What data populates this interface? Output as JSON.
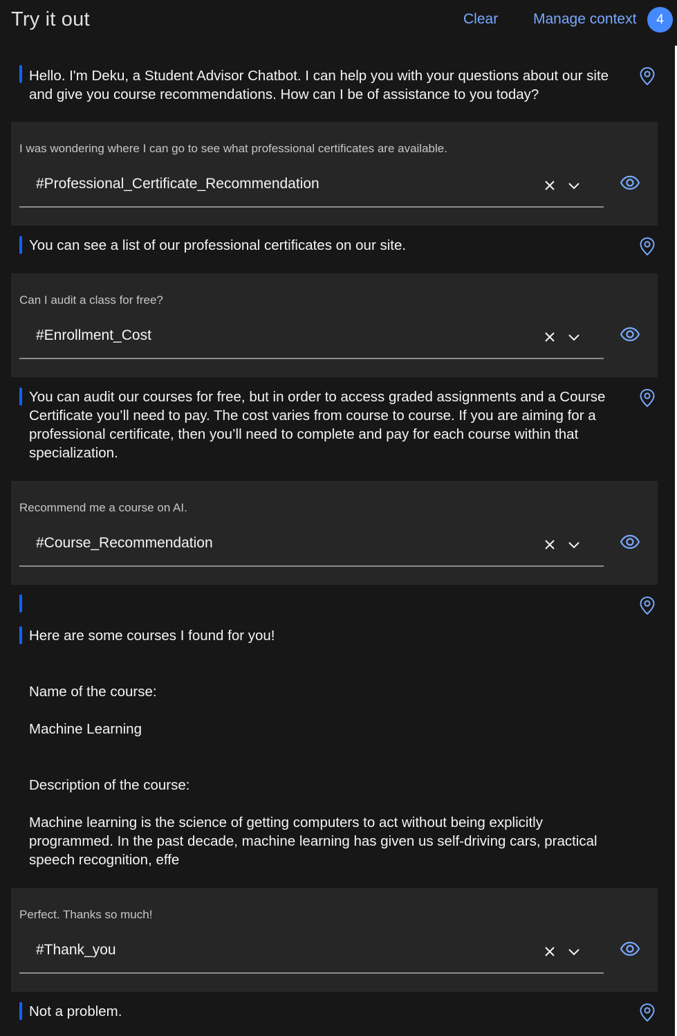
{
  "header": {
    "title": "Try it out",
    "clear_label": "Clear",
    "manage_context_label": "Manage context",
    "context_count": "4"
  },
  "colors": {
    "background": "#171717",
    "user_box": "#262626",
    "accent_link": "#78a9ff",
    "badge": "#4589ff",
    "bot_bar": "#0f62fe"
  },
  "messages": {
    "bot1": "Hello. I'm Deku, a Student Advisor Chatbot. I can help you with your questions about our site and give you course recommendations. How can I be of assistance to you today?",
    "user1": {
      "text": "I was wondering where I can go to see what professional certificates are available.",
      "intent": "#Professional_Certificate_Recommendation"
    },
    "bot2": "You can see a list of our professional certificates on our site.",
    "user2": {
      "text": "Can I audit a class for free?",
      "intent": "#Enrollment_Cost"
    },
    "bot3": "You can audit our courses for free, but in order to access graded assignments and a Course Certificate you’ll need to pay. The cost varies from course to course. If you are aiming for a professional certificate, then you’ll need to complete and pay for each course within that specialization.",
    "user3": {
      "text": "Recommend me a course on AI.",
      "intent": "#Course_Recommendation"
    },
    "bot4_intro": "Here are some courses I found for you!",
    "bot4_name_label": "Name of the course:",
    "bot4_name_value": "Machine Learning",
    "bot4_desc_label": "Description of the course:",
    "bot4_desc_value": "Machine learning is the science of getting computers to act without being explicitly programmed. In the past decade, machine learning has given us self-driving cars, practical speech recognition, effe",
    "user4": {
      "text": "Perfect. Thanks so much!",
      "intent": "#Thank_you"
    },
    "bot5": "Not a problem."
  },
  "icons": {
    "location": "location-pin-icon",
    "eye": "eye-icon",
    "clear": "close-icon",
    "dropdown": "chevron-down-icon"
  }
}
